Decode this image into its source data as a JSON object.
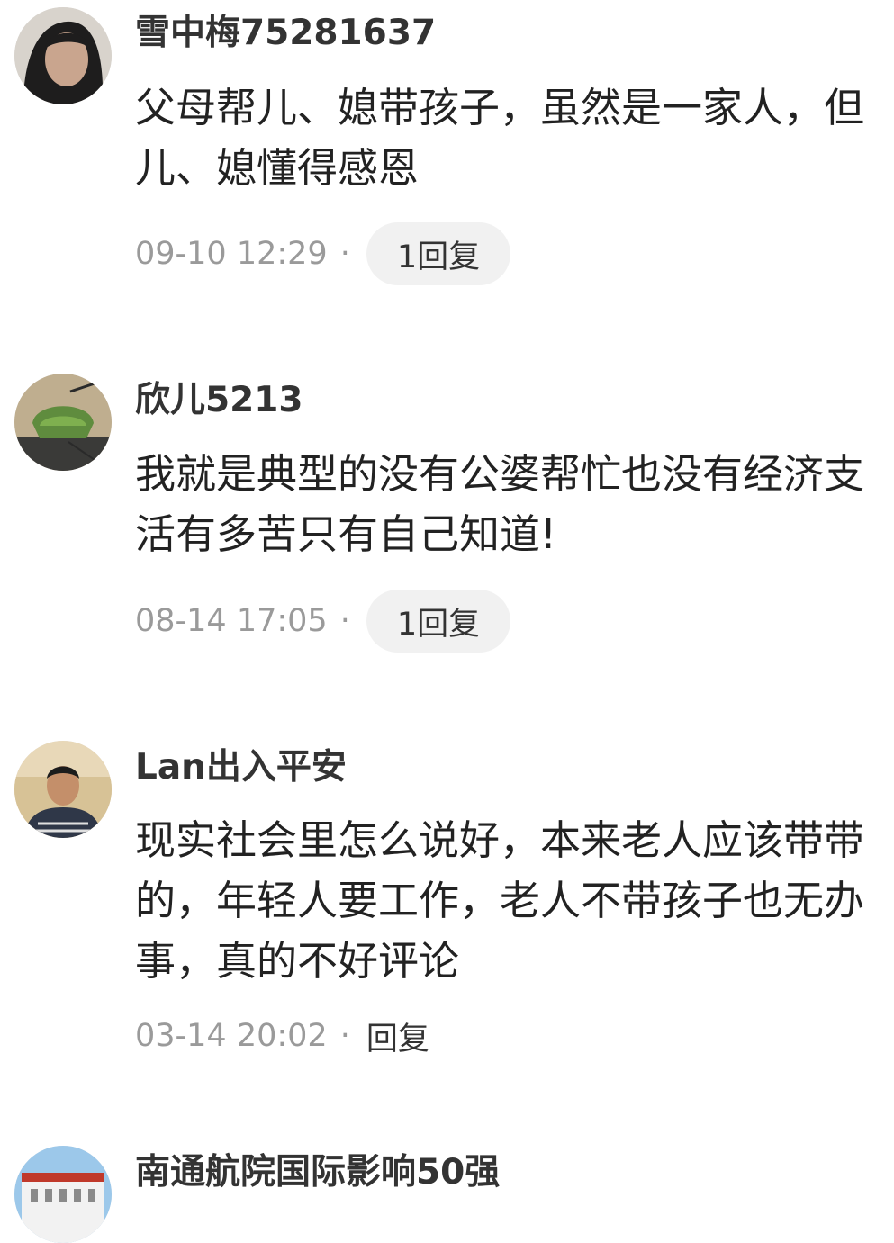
{
  "comments": [
    {
      "username": "雪中梅75281637",
      "lines": [
        "父母帮儿、媳带孩子，虽然是一家人，但",
        "儿、媳懂得感恩"
      ],
      "time": "09-10 12:29",
      "separator": "·",
      "reply_label": "1回复"
    },
    {
      "username": "欣儿5213",
      "lines": [
        "我就是典型的没有公婆帮忙也没有经济支",
        "活有多苦只有自己知道!"
      ],
      "time": "08-14 17:05",
      "separator": "·",
      "reply_label": "1回复"
    },
    {
      "username": "Lan出入平安",
      "lines": [
        "现实社会里怎么说好，本来老人应该带带",
        "的，年轻人要工作，老人不带孩子也无办",
        "事，真的不好评论"
      ],
      "time": "03-14 20:02",
      "separator": "·",
      "reply_label": "回复"
    },
    {
      "username": "南通航院国际影响50强"
    }
  ],
  "colors": {
    "text": "#222222",
    "meta": "#9a9a9a",
    "pill_bg": "#f1f1f1"
  }
}
